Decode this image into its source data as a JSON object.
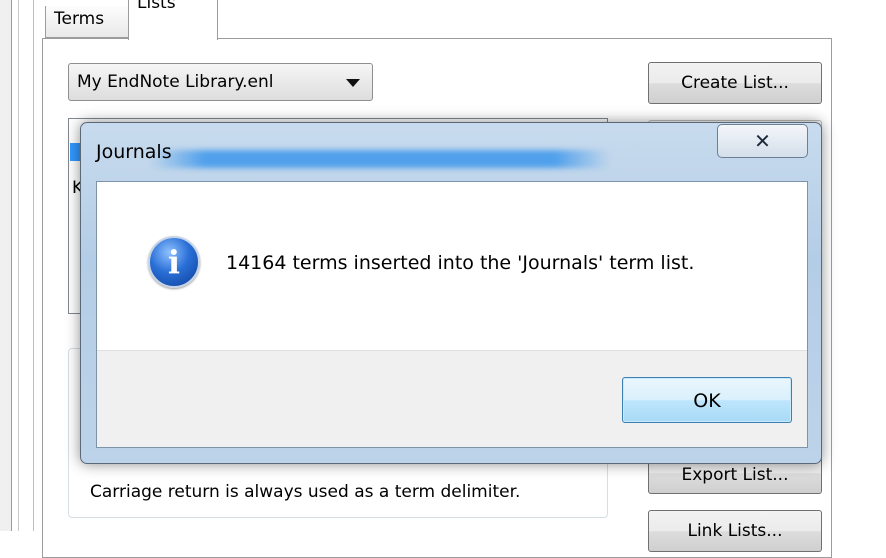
{
  "tabs": [
    {
      "label": "Terms"
    },
    {
      "label": "Lists"
    }
  ],
  "library_select": {
    "value": "My EndNote Library.enl"
  },
  "buttons": {
    "create_list": "Create List...",
    "export_list": "Export List...",
    "link_lists": "Link Lists..."
  },
  "lists_box": {
    "visible_fragment": "K"
  },
  "delimiter_note": "Carriage return is always used as a term delimiter.",
  "dialog": {
    "title": "Journals",
    "close_glyph": "✕",
    "icon": "info-icon",
    "message": "14164 terms inserted into the 'Journals' term list.",
    "ok_label": "OK"
  }
}
